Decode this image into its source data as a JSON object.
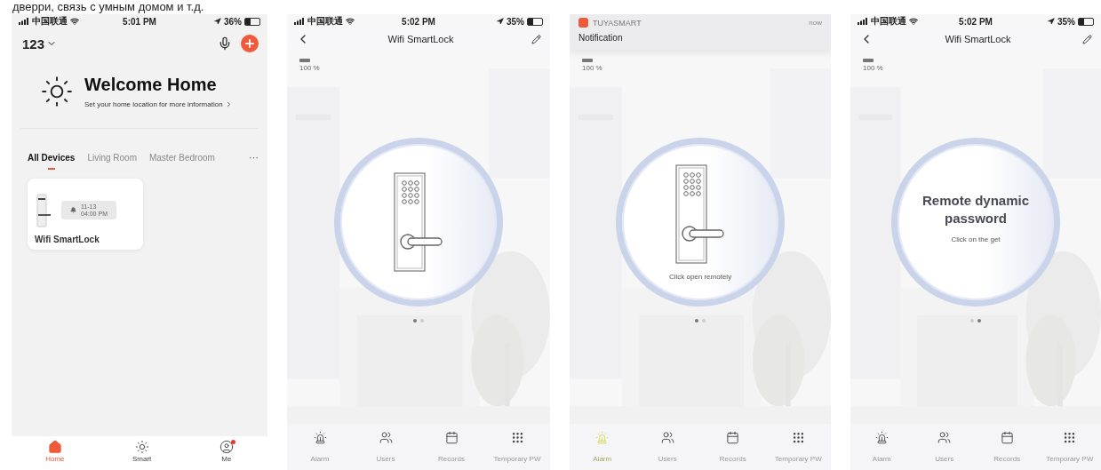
{
  "caption": "дверри, связь с умным домом и т.д.",
  "home_screen": {
    "status_bar": {
      "carrier": "中国联通",
      "time": "5:01 PM",
      "battery": "36%"
    },
    "home_name": "123",
    "welcome": {
      "title": "Welcome Home",
      "subtitle": "Set your home location for more information"
    },
    "tabs": [
      {
        "label": "All Devices",
        "selected": true
      },
      {
        "label": "Living Room",
        "selected": false
      },
      {
        "label": "Master Bedroom",
        "selected": false
      }
    ],
    "more": "···",
    "devices": [
      {
        "name": "Wifi SmartLock",
        "date": "11-13",
        "time": "04:00 PM"
      }
    ],
    "nav": [
      {
        "label": "Home",
        "kind": "home",
        "selected": true,
        "badge": false
      },
      {
        "label": "Smart",
        "kind": "smart",
        "selected": false,
        "badge": false
      },
      {
        "label": "Me",
        "kind": "me",
        "selected": false,
        "badge": true
      }
    ]
  },
  "lock_screens": [
    {
      "top": {
        "kind": "status",
        "carrier": "中国联通",
        "time": "5:02 PM",
        "battery": "35%"
      },
      "title": "Wifi SmartLock",
      "battery": "100 %",
      "slide": {
        "kind": "lock"
      },
      "pages": [
        {
          "selected": true
        },
        {
          "selected": false
        }
      ],
      "actions": [
        {
          "label": "Alarm",
          "kind": "alarm",
          "active": false
        },
        {
          "label": "Users",
          "kind": "users",
          "active": false
        },
        {
          "label": "Records",
          "kind": "records",
          "active": false
        },
        {
          "label": "Temporary PW",
          "kind": "keypad",
          "active": false
        }
      ]
    },
    {
      "top": {
        "kind": "notification",
        "app": "TUYASMART",
        "when": "now",
        "message": "Notification"
      },
      "battery": "100 %",
      "slide": {
        "kind": "lock",
        "hint": "Click open remotely"
      },
      "pages": [
        {
          "selected": true
        },
        {
          "selected": false
        }
      ],
      "actions": [
        {
          "label": "Alarm",
          "kind": "alarm",
          "active": true
        },
        {
          "label": "Users",
          "kind": "users",
          "active": false
        },
        {
          "label": "Records",
          "kind": "records",
          "active": false
        },
        {
          "label": "Temporary PW",
          "kind": "keypad",
          "active": false
        }
      ]
    },
    {
      "top": {
        "kind": "status",
        "carrier": "中国联通",
        "time": "5:02 PM",
        "battery": "35%"
      },
      "title": "Wifi SmartLock",
      "battery": "100 %",
      "slide": {
        "kind": "text",
        "heading": "Remote dynamic password",
        "hint": "Click on the get"
      },
      "pages": [
        {
          "selected": false
        },
        {
          "selected": true
        }
      ],
      "actions": [
        {
          "label": "Alarm",
          "kind": "alarm",
          "active": false
        },
        {
          "label": "Users",
          "kind": "users",
          "active": false
        },
        {
          "label": "Records",
          "kind": "records",
          "active": false
        },
        {
          "label": "Temporary PW",
          "kind": "keypad",
          "active": false
        }
      ]
    }
  ]
}
